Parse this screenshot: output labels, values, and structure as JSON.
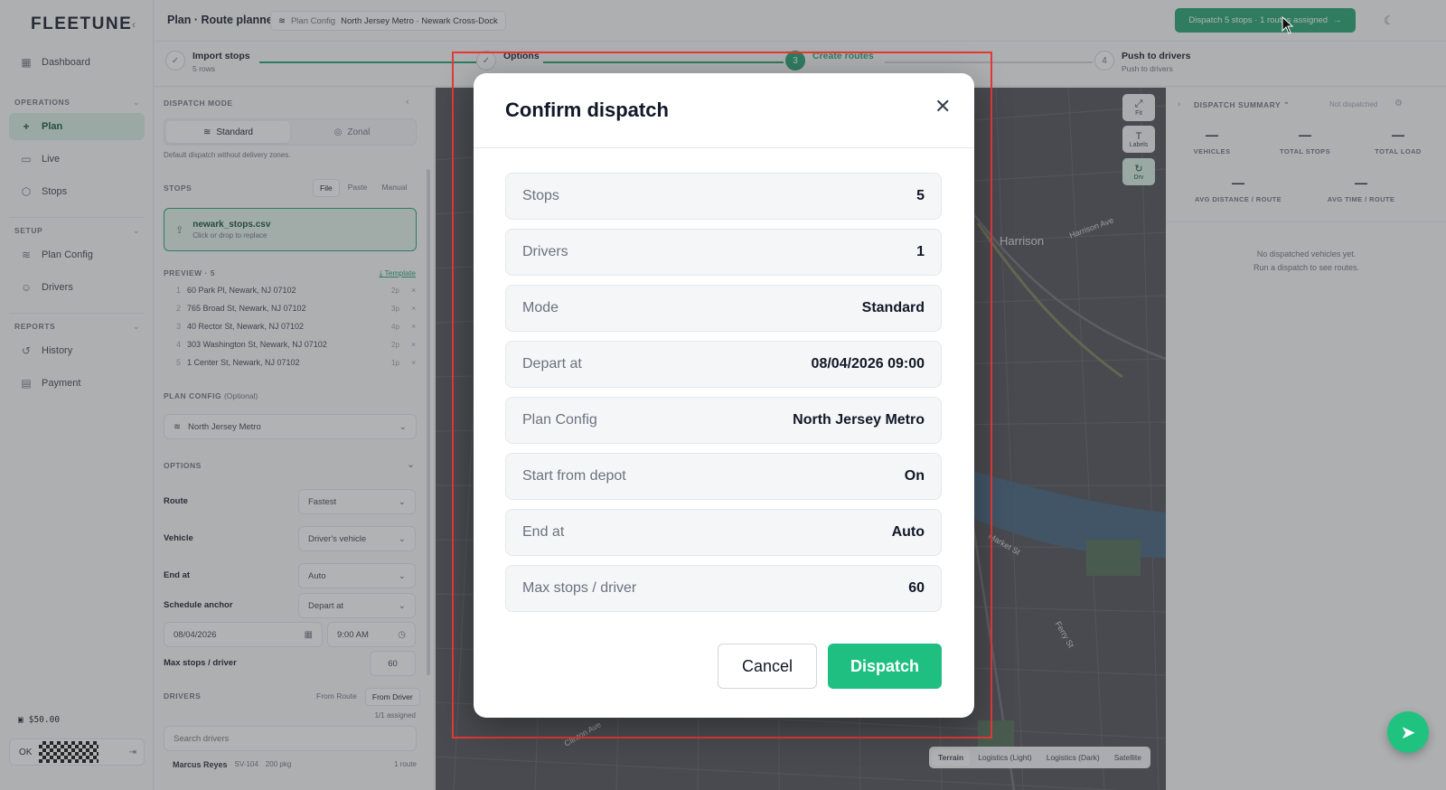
{
  "app": {
    "logo": "FLEETUNE"
  },
  "sidebar": {
    "main": [
      {
        "label": "Dashboard"
      }
    ],
    "sections": [
      {
        "title": "OPERATIONS",
        "items": [
          {
            "label": "Plan"
          },
          {
            "label": "Live"
          },
          {
            "label": "Stops"
          }
        ]
      },
      {
        "title": "SETUP",
        "items": [
          {
            "label": "Plan Config"
          },
          {
            "label": "Drivers"
          }
        ]
      },
      {
        "title": "REPORTS",
        "items": [
          {
            "label": "History"
          },
          {
            "label": "Payment"
          }
        ]
      }
    ],
    "balance": "$50.00",
    "footer_status": "OK"
  },
  "topbar": {
    "title": "Plan · Route planner",
    "config_label": "Plan Config",
    "config_value": "North Jersey Metro · Newark Cross-Dock",
    "dispatch_button": "Dispatch 5 stops · 1 routes assigned"
  },
  "stepper": {
    "steps": [
      {
        "title": "Import stops",
        "sub": "5 rows",
        "badge": "✓"
      },
      {
        "title": "Options",
        "sub": "",
        "badge": "✓"
      },
      {
        "title": "Create routes",
        "sub": "",
        "badge": "3"
      },
      {
        "title": "Push to drivers",
        "sub": "Push to drivers",
        "badge": "4"
      }
    ]
  },
  "left_panel": {
    "dispatch_mode_label": "DISPATCH MODE",
    "modes": [
      "Standard",
      "Zonal"
    ],
    "mode_hint": "Default dispatch without delivery zones.",
    "stops_label": "STOPS",
    "stops_tabs": [
      "File",
      "Paste",
      "Manual"
    ],
    "file": {
      "name": "newark_stops.csv",
      "sub": "Click or drop to replace"
    },
    "preview_label": "PREVIEW · 5",
    "template_link": "Template",
    "preview_rows": [
      {
        "num": "1",
        "address": "60 Park Pl, Newark, NJ 07102",
        "count": "2p"
      },
      {
        "num": "2",
        "address": "765 Broad St, Newark, NJ 07102",
        "count": "3p"
      },
      {
        "num": "3",
        "address": "40 Rector St, Newark, NJ 07102",
        "count": "4p"
      },
      {
        "num": "4",
        "address": "303 Washington St, Newark, NJ 07102",
        "count": "2p"
      },
      {
        "num": "5",
        "address": "1 Center St, Newark, NJ 07102",
        "count": "1p"
      }
    ],
    "plan_config_label": "PLAN CONFIG",
    "plan_config_optional": "(Optional)",
    "plan_config_value": "North Jersey Metro",
    "options_label": "OPTIONS",
    "options": {
      "route_label": "Route",
      "route_value": "Fastest",
      "vehicle_label": "Vehicle",
      "vehicle_value": "Driver's vehicle",
      "end_label": "End at",
      "end_value": "Auto",
      "anchor_label": "Schedule anchor",
      "anchor_value": "Depart at",
      "date_value": "08/04/2026",
      "time_value": "9:00 AM",
      "max_label": "Max stops / driver",
      "max_value": "60"
    },
    "drivers_label": "DRIVERS",
    "drivers_tabs": [
      "From Route",
      "From Driver"
    ],
    "drivers_assigned": "1/1 assigned",
    "drivers_search_placeholder": "Search drivers",
    "driver": {
      "name": "Marcus Reyes",
      "id": "SV-104",
      "capacity": "200 pkg",
      "routes": "1 route"
    }
  },
  "map": {
    "labels": [
      {
        "text": "Harrison"
      },
      {
        "text": "Harrison Ave"
      },
      {
        "text": "Market St"
      },
      {
        "text": "Ferry St"
      },
      {
        "text": "Clinton Ave"
      }
    ],
    "controls": [
      {
        "label": "Fit"
      },
      {
        "label": "Labels"
      },
      {
        "label": "Drv"
      }
    ],
    "layers": [
      "Terrain",
      "Logistics (Light)",
      "Logistics (Dark)",
      "Satellite"
    ],
    "active_layer": "Terrain"
  },
  "right_panel": {
    "title": "DISPATCH SUMMARY",
    "status": "Not dispatched",
    "metrics": [
      {
        "value": "—",
        "label": "VEHICLES"
      },
      {
        "value": "—",
        "label": "TOTAL STOPS"
      },
      {
        "value": "—",
        "label": "TOTAL LOAD"
      },
      {
        "value": "—",
        "label": "AVG DISTANCE / ROUTE"
      },
      {
        "value": "—",
        "label": "AVG TIME / ROUTE"
      }
    ],
    "empty_line1": "No dispatched vehicles yet.",
    "empty_line2": "Run a dispatch to see routes."
  },
  "modal": {
    "title": "Confirm dispatch",
    "rows": [
      {
        "label": "Stops",
        "value": "5"
      },
      {
        "label": "Drivers",
        "value": "1"
      },
      {
        "label": "Mode",
        "value": "Standard"
      },
      {
        "label": "Depart at",
        "value": "08/04/2026 09:00"
      },
      {
        "label": "Plan Config",
        "value": "North Jersey Metro"
      },
      {
        "label": "Start from depot",
        "value": "On"
      },
      {
        "label": "End at",
        "value": "Auto"
      },
      {
        "label": "Max stops / driver",
        "value": "60"
      }
    ],
    "cancel_label": "Cancel",
    "dispatch_label": "Dispatch"
  },
  "colors": {
    "accent": "#1fbf82",
    "accent_dark": "#1fa36e",
    "highlight": "#e53935"
  }
}
